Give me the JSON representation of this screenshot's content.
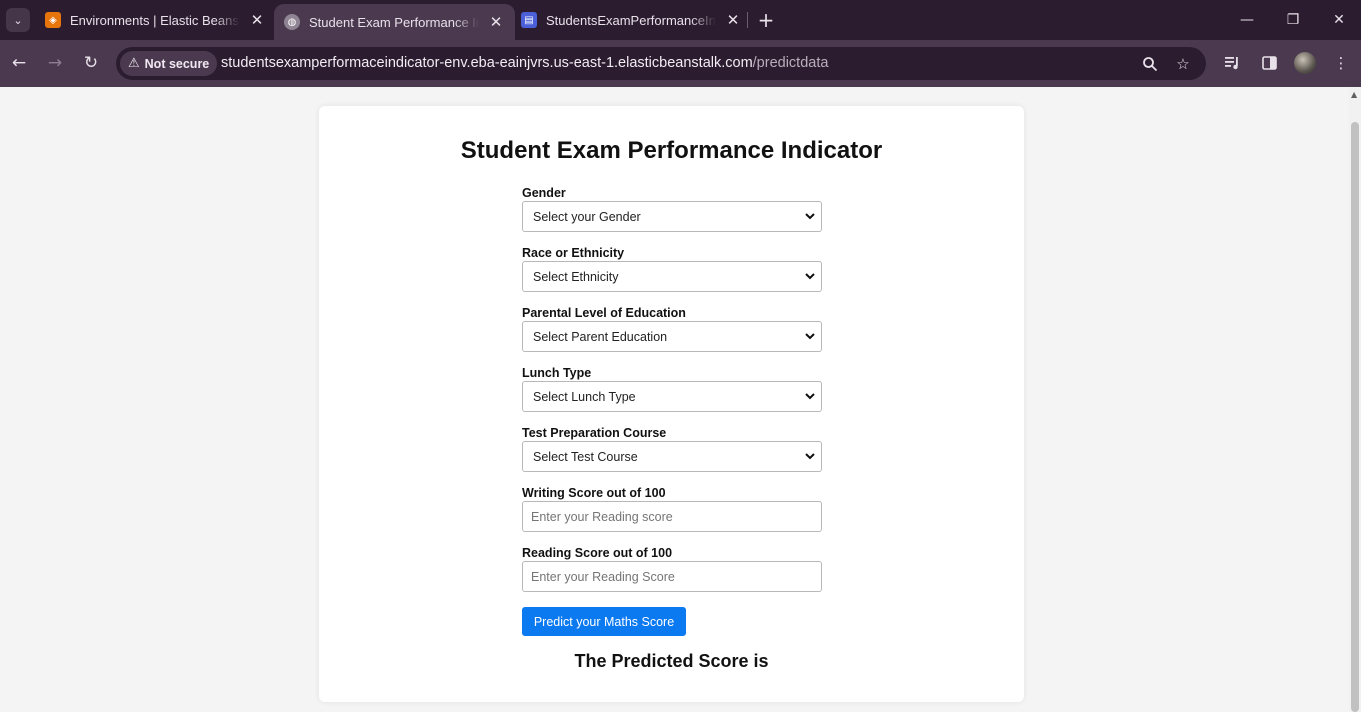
{
  "browser": {
    "tabs": [
      {
        "title": "Environments | Elastic Beanstalk",
        "favicon": "aws-beanstalk-icon",
        "active": false
      },
      {
        "title": "Student Exam Performance Indicator",
        "favicon": "globe-icon",
        "active": true
      },
      {
        "title": "StudentsExamPerformanceIndicator",
        "favicon": "codepipeline-icon",
        "active": false
      }
    ],
    "security_label": "Not secure",
    "url_host": "studentsexamperformaceindicator-env.eba-eainjvrs.us-east-1.elasticbeanstalk.com",
    "url_path": "/predictdata"
  },
  "page": {
    "title": "Student Exam Performance Indicator",
    "fields": {
      "gender": {
        "label": "Gender",
        "value": "Select your Gender"
      },
      "ethnicity": {
        "label": "Race or Ethnicity",
        "value": "Select Ethnicity"
      },
      "parent_education": {
        "label": "Parental Level of Education",
        "value": "Select Parent Education"
      },
      "lunch": {
        "label": "Lunch Type",
        "value": "Select Lunch Type"
      },
      "test_prep": {
        "label": "Test Preparation Course",
        "value": "Select Test Course"
      },
      "writing": {
        "label": "Writing Score out of 100",
        "placeholder": "Enter your Reading score"
      },
      "reading": {
        "label": "Reading Score out of 100",
        "placeholder": "Enter your Reading Score"
      }
    },
    "submit_label": "Predict your Maths Score",
    "result_text": "The Predicted Score is"
  },
  "colors": {
    "primary_button": "#0b79f0",
    "chrome_frame": "#2b1d2f",
    "chrome_toolbar": "#4b3a4f"
  }
}
